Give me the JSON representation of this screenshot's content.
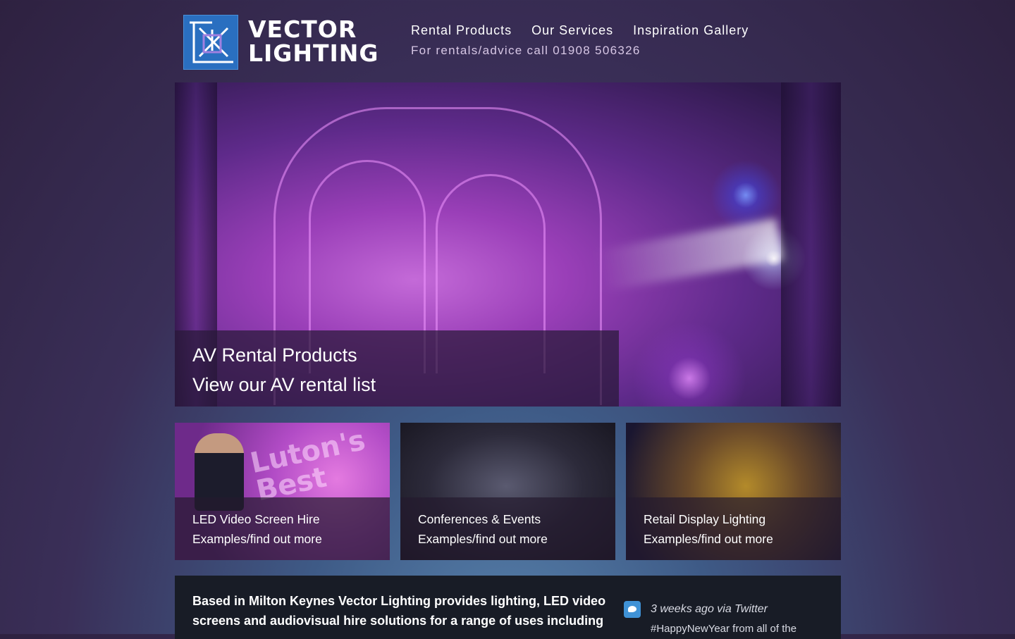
{
  "brand": {
    "line1": "VECTOR",
    "line2": "LIGHTING"
  },
  "nav": {
    "items": [
      "Rental Products",
      "Our Services",
      "Inspiration Gallery"
    ],
    "phone": "For rentals/advice call 01908 506326"
  },
  "hero": {
    "title": "AV Rental Products",
    "link": "View our AV rental list"
  },
  "tiles": [
    {
      "title": "LED Video Screen Hire",
      "link": "Examples/find out more",
      "banner": "Luton's Best"
    },
    {
      "title": "Conferences & Events",
      "link": "Examples/find out more"
    },
    {
      "title": "Retail Display Lighting",
      "link": "Examples/find out more"
    }
  ],
  "info": {
    "text": "Based in Milton Keynes Vector Lighting provides lighting, LED video screens and audiovisual hire solutions for a range of uses including",
    "twitter_meta": "3 weeks ago via Twitter",
    "twitter_text": "#HappyNewYear from all of the",
    "twitter_icon": "twitter-bird-icon"
  }
}
